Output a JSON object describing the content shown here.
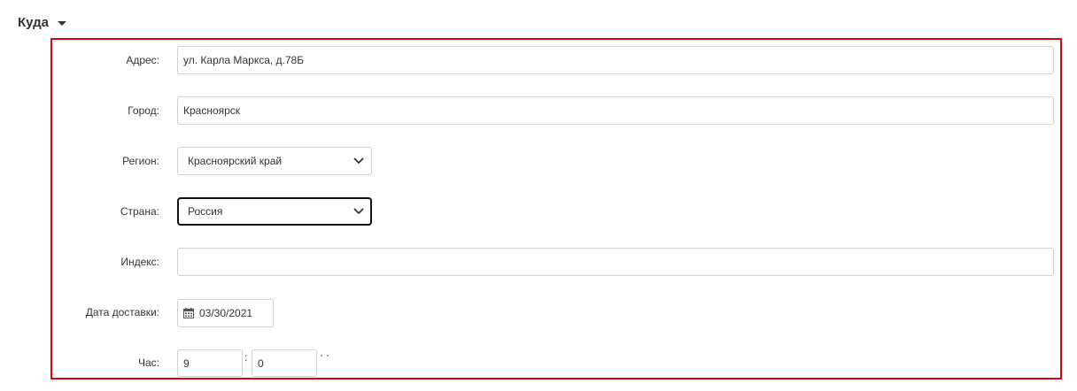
{
  "section": {
    "title": "Куда"
  },
  "form": {
    "address": {
      "label": "Адрес:",
      "value": "ул. Карла Маркса, д.78Б"
    },
    "city": {
      "label": "Город:",
      "value": "Красноярск"
    },
    "region": {
      "label": "Регион:",
      "value": "Красноярский край"
    },
    "country": {
      "label": "Страна:",
      "value": "Россия"
    },
    "index": {
      "label": "Индекс:",
      "value": ""
    },
    "delivery_date": {
      "label": "Дата доставки:",
      "value": "03/30/2021"
    },
    "hour": {
      "label": "Час:",
      "hours": "9",
      "separator": ":",
      "minutes": "0"
    }
  },
  "icons": {
    "caret": "caret-down-icon",
    "select_arrow": "chevron-down-icon",
    "calendar": "calendar-icon"
  },
  "colors": {
    "highlight": "#e0000f",
    "field_border": "#d0d0d0",
    "focus_border": "#111111"
  }
}
